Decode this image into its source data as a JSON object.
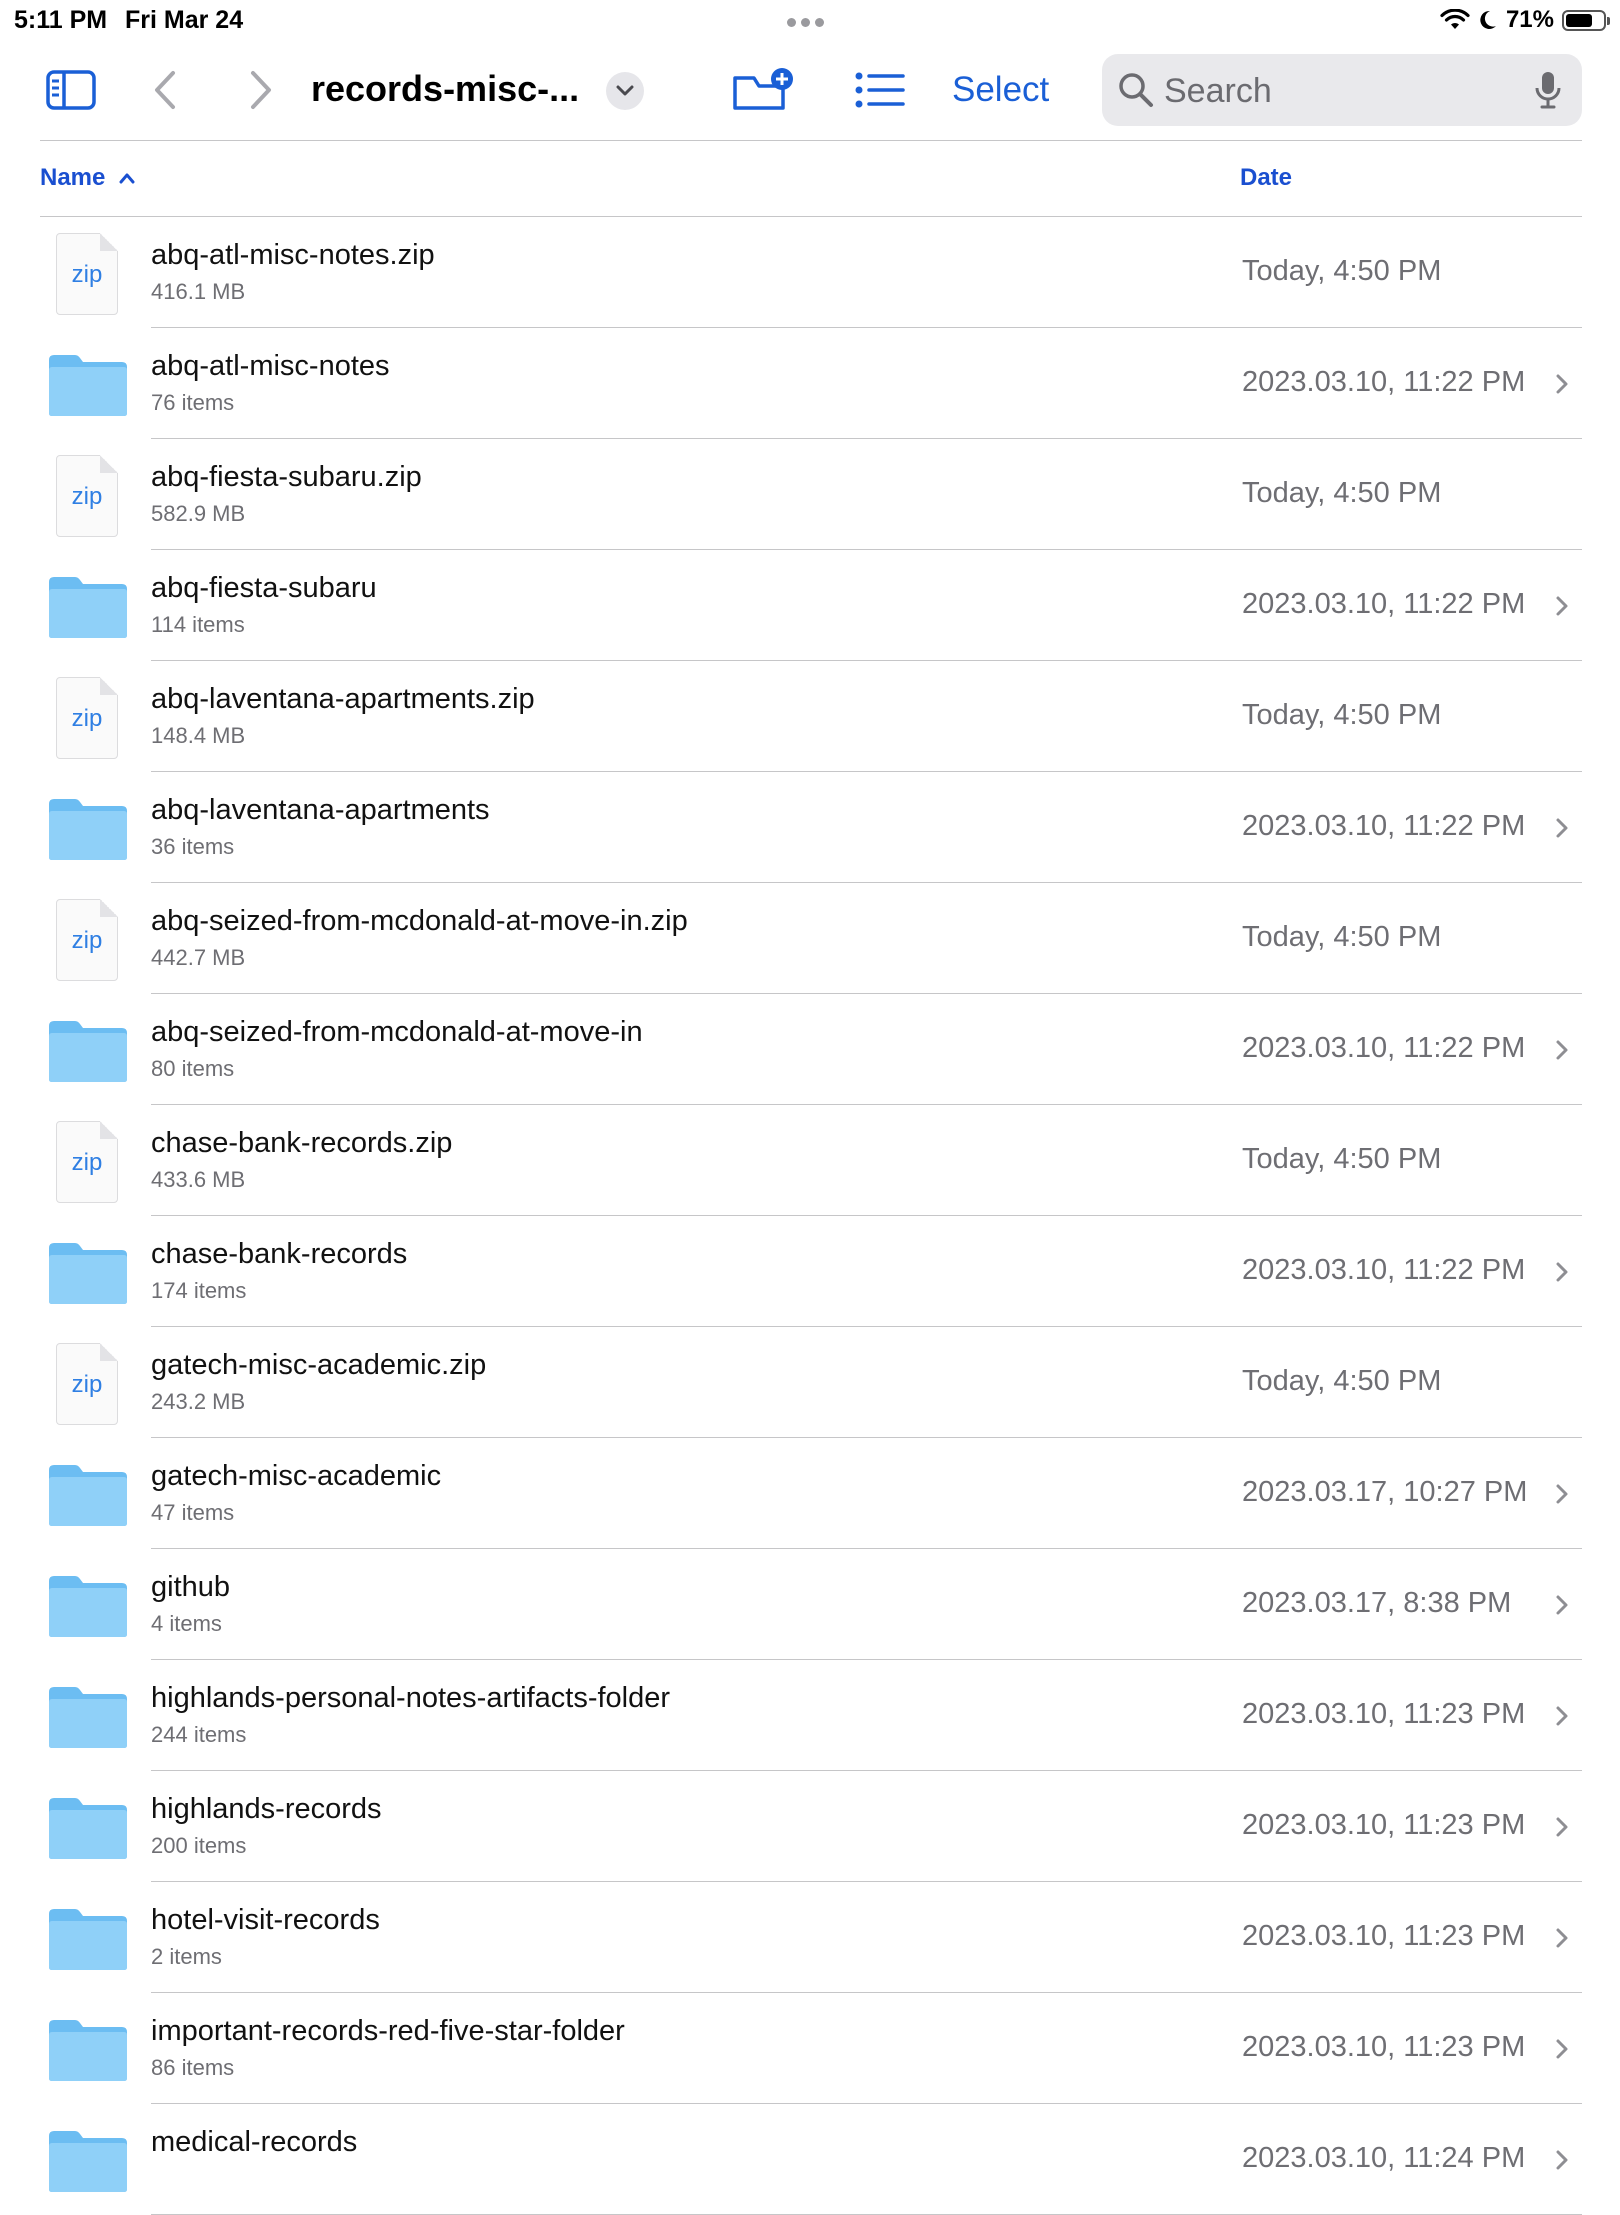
{
  "status_bar": {
    "time": "5:11 PM",
    "date": "Fri Mar 24",
    "battery_percent": "71%",
    "battery_level": 0.71
  },
  "toolbar": {
    "folder_title": "records-misc-...",
    "select_label": "Select",
    "search_placeholder": "Search"
  },
  "columns": {
    "name": "Name",
    "date": "Date"
  },
  "files": [
    {
      "name": "abq-atl-misc-notes.zip",
      "detail": "416.1 MB",
      "date": "Today, 4:50 PM",
      "type": "zip"
    },
    {
      "name": "abq-atl-misc-notes",
      "detail": "76 items",
      "date": "2023.03.10, 11:22 PM",
      "type": "folder"
    },
    {
      "name": "abq-fiesta-subaru.zip",
      "detail": "582.9 MB",
      "date": "Today, 4:50 PM",
      "type": "zip"
    },
    {
      "name": "abq-fiesta-subaru",
      "detail": "114 items",
      "date": "2023.03.10, 11:22 PM",
      "type": "folder"
    },
    {
      "name": "abq-laventana-apartments.zip",
      "detail": "148.4 MB",
      "date": "Today, 4:50 PM",
      "type": "zip"
    },
    {
      "name": "abq-laventana-apartments",
      "detail": "36 items",
      "date": "2023.03.10, 11:22 PM",
      "type": "folder"
    },
    {
      "name": "abq-seized-from-mcdonald-at-move-in.zip",
      "detail": "442.7 MB",
      "date": "Today, 4:50 PM",
      "type": "zip"
    },
    {
      "name": "abq-seized-from-mcdonald-at-move-in",
      "detail": "80 items",
      "date": "2023.03.10, 11:22 PM",
      "type": "folder"
    },
    {
      "name": "chase-bank-records.zip",
      "detail": "433.6 MB",
      "date": "Today, 4:50 PM",
      "type": "zip"
    },
    {
      "name": "chase-bank-records",
      "detail": "174 items",
      "date": "2023.03.10, 11:22 PM",
      "type": "folder"
    },
    {
      "name": "gatech-misc-academic.zip",
      "detail": "243.2 MB",
      "date": "Today, 4:50 PM",
      "type": "zip"
    },
    {
      "name": "gatech-misc-academic",
      "detail": "47 items",
      "date": "2023.03.17, 10:27 PM",
      "type": "folder"
    },
    {
      "name": "github",
      "detail": "4 items",
      "date": "2023.03.17, 8:38 PM",
      "type": "folder"
    },
    {
      "name": "highlands-personal-notes-artifacts-folder",
      "detail": "244 items",
      "date": "2023.03.10, 11:23 PM",
      "type": "folder"
    },
    {
      "name": "highlands-records",
      "detail": "200 items",
      "date": "2023.03.10, 11:23 PM",
      "type": "folder"
    },
    {
      "name": "hotel-visit-records",
      "detail": "2 items",
      "date": "2023.03.10, 11:23 PM",
      "type": "folder"
    },
    {
      "name": "important-records-red-five-star-folder",
      "detail": "86 items",
      "date": "2023.03.10, 11:23 PM",
      "type": "folder"
    },
    {
      "name": "medical-records",
      "detail": "",
      "date": "2023.03.10, 11:24 PM",
      "type": "folder"
    }
  ],
  "zip_icon_label": "zip",
  "colors": {
    "accent": "#1a5fd6",
    "header_blue": "#1a4fd0",
    "folder_blue": "#7cc7f5",
    "secondary_text": "#6e6e73",
    "separator": "#c6c6c8"
  }
}
